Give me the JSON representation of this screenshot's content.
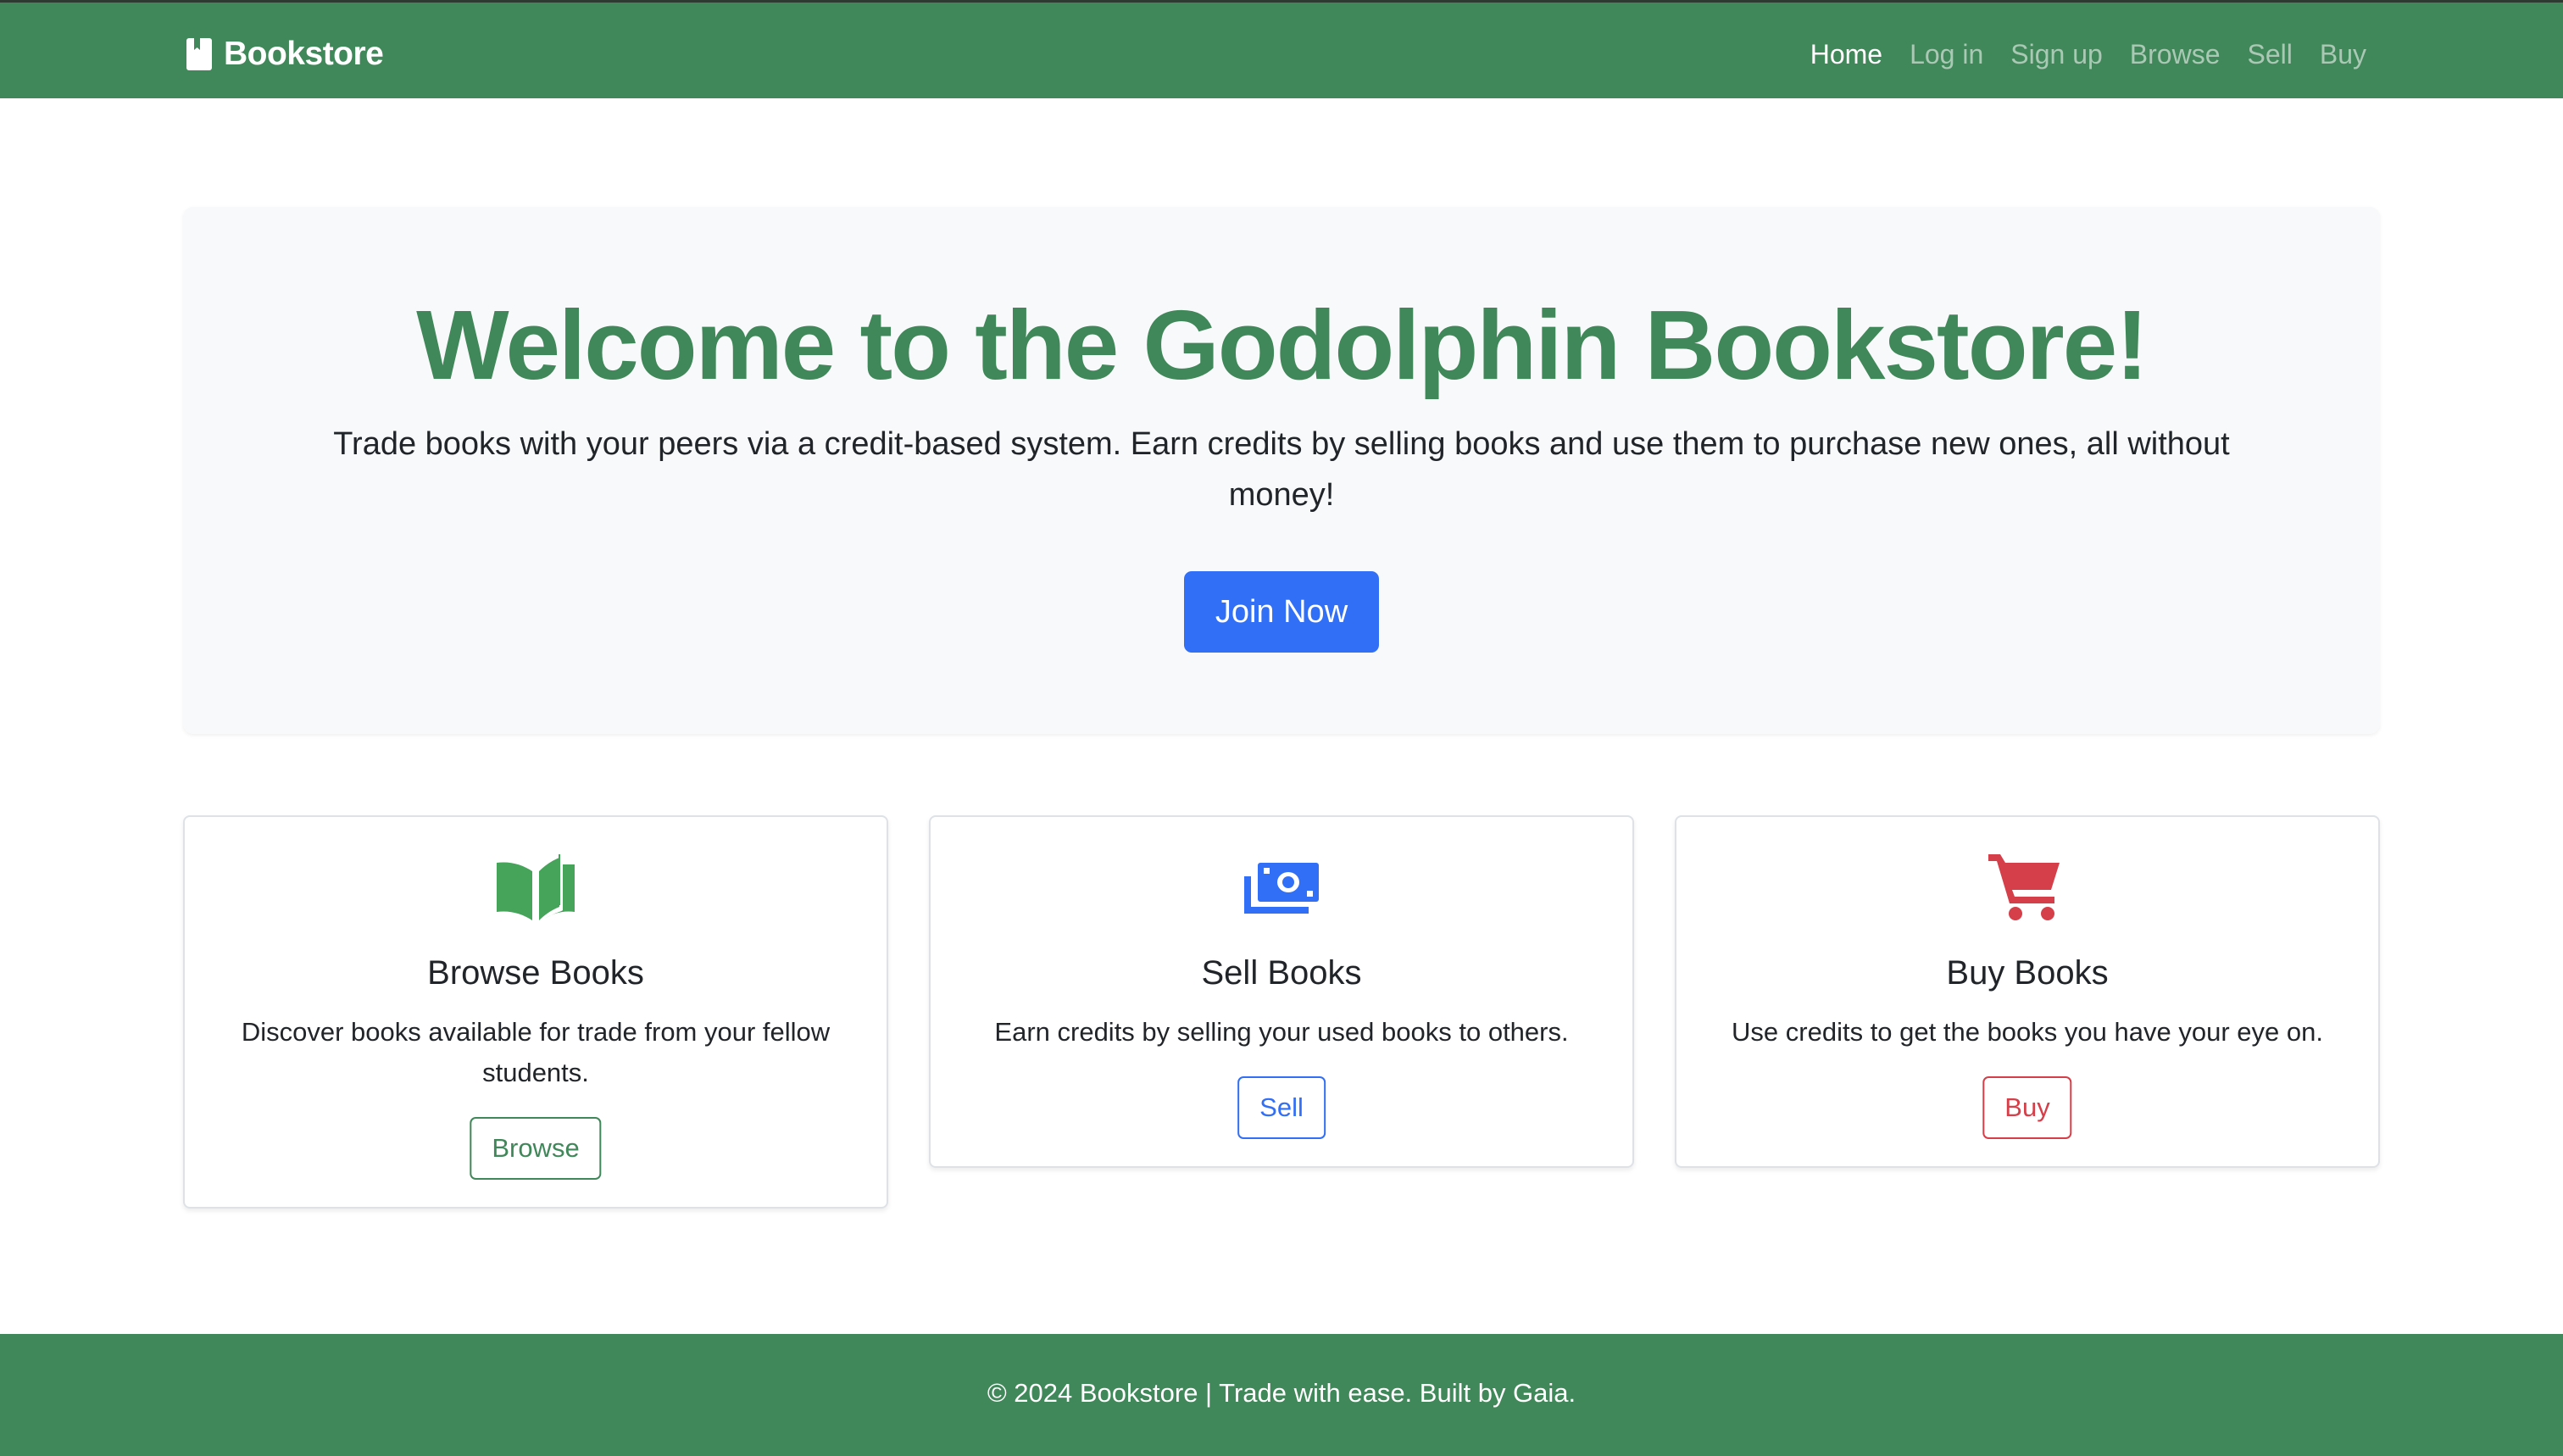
{
  "navbar": {
    "brand": "Bookstore",
    "brand_icon": "book-icon",
    "links": [
      {
        "label": "Home",
        "active": true
      },
      {
        "label": "Log in"
      },
      {
        "label": "Sign up"
      },
      {
        "label": "Browse"
      },
      {
        "label": "Sell"
      },
      {
        "label": "Buy"
      }
    ]
  },
  "hero": {
    "title": "Welcome to the Godolphin Bookstore!",
    "lead": "Trade books with your peers via a credit-based system. Earn credits by selling books and use them to purchase new ones, all without money!",
    "cta_label": "Join Now"
  },
  "cards": [
    {
      "icon": "open-book-icon",
      "title": "Browse Books",
      "text": "Discover books available for trade from your fellow students.",
      "button": "Browse"
    },
    {
      "icon": "money-bill-icon",
      "title": "Sell Books",
      "text": "Earn credits by selling your used books to others.",
      "button": "Sell"
    },
    {
      "icon": "shopping-cart-icon",
      "title": "Buy Books",
      "text": "Use credits to get the books you have your eye on.",
      "button": "Buy"
    }
  ],
  "footer": {
    "text": "© 2024 Bookstore | Trade with ease. Built by Gaia."
  },
  "colors": {
    "brand_green": "#408759",
    "primary_blue": "#316ff6",
    "danger_red": "#d43f4a",
    "hero_bg": "#f8f9fa"
  }
}
